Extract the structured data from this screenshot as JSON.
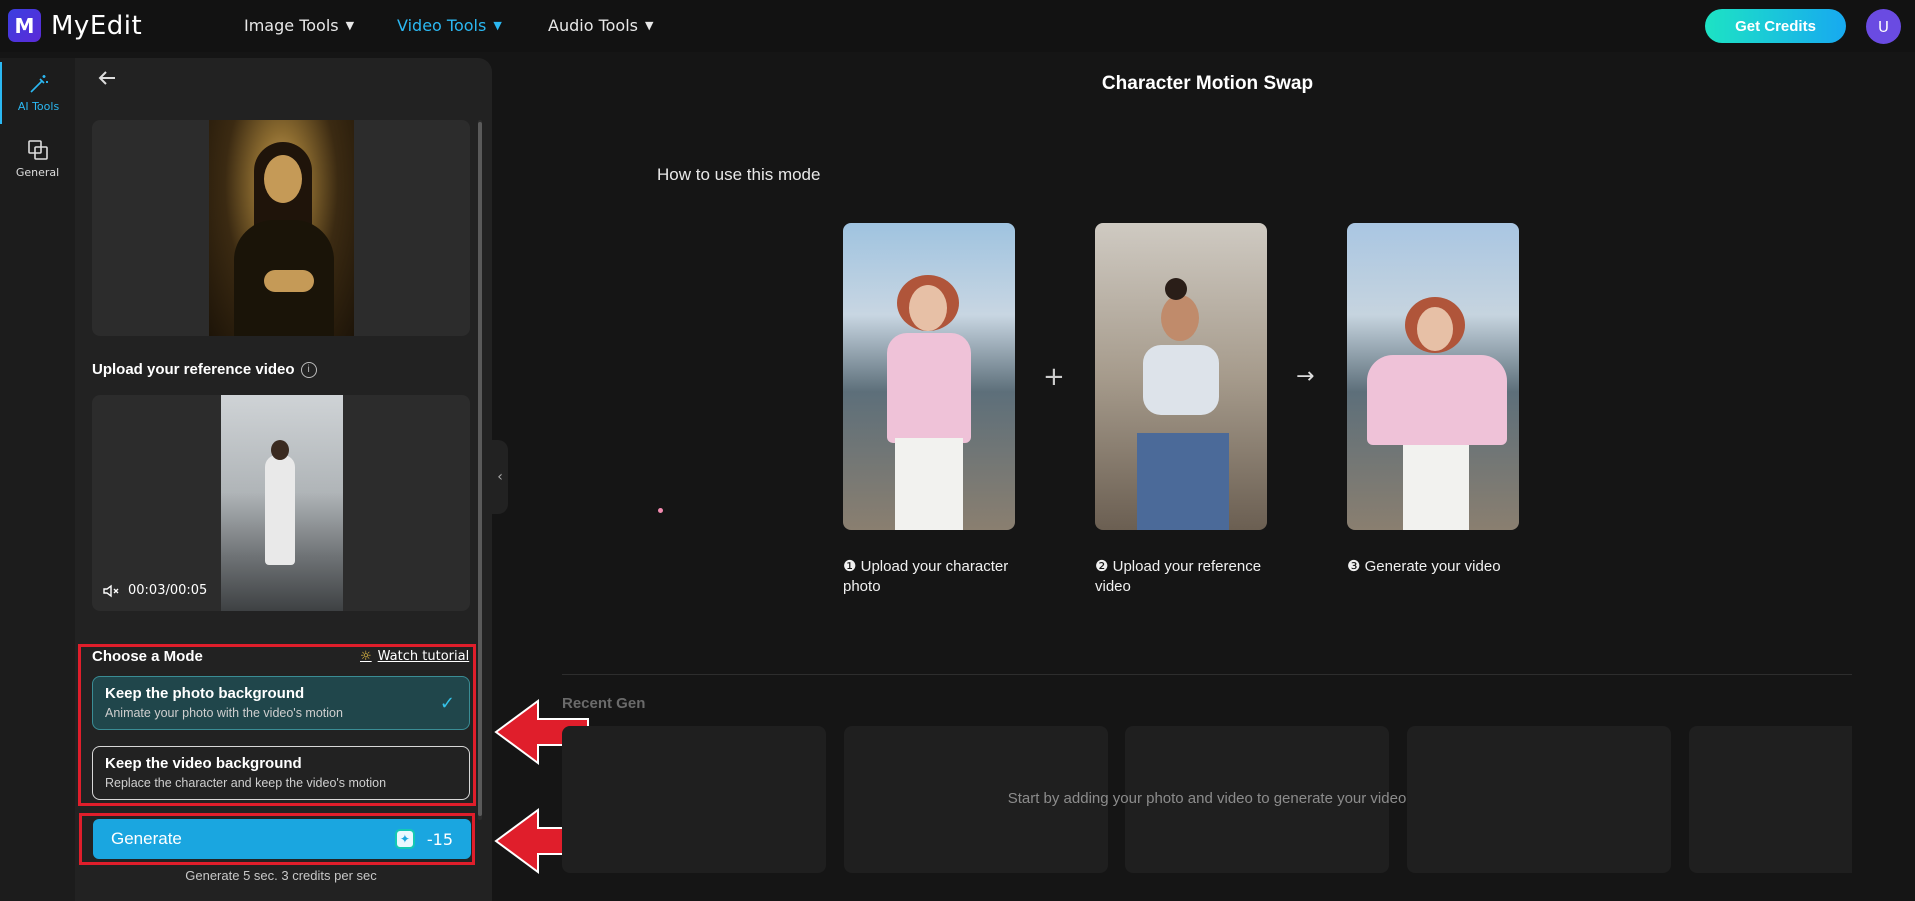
{
  "app": {
    "name": "MyEdit",
    "logo_letter": "M"
  },
  "nav": [
    {
      "label": "Image Tools",
      "active": false
    },
    {
      "label": "Video Tools",
      "active": true
    },
    {
      "label": "Audio Tools",
      "active": false
    }
  ],
  "header": {
    "credits_label": "Get Credits",
    "avatar_letter": "U"
  },
  "rail": [
    {
      "label": "AI Tools",
      "icon": "magic-wand-icon",
      "active": true
    },
    {
      "label": "General",
      "icon": "layers-icon",
      "active": false
    }
  ],
  "panel": {
    "reference_label": "Upload your reference video",
    "video_time": "00:03/00:05",
    "mode_title": "Choose a Mode",
    "watch_tutorial": "Watch tutorial",
    "modes": [
      {
        "title": "Keep the photo background",
        "desc": "Animate your photo with the video's motion",
        "selected": true
      },
      {
        "title": "Keep the video background",
        "desc": "Replace the character and keep the video's motion",
        "selected": false
      }
    ],
    "generate_label": "Generate",
    "generate_cost": "-15",
    "generate_note": "Generate 5 sec. 3 credits per sec"
  },
  "main": {
    "title": "Character Motion Swap",
    "howto": "How to use this mode",
    "steps": [
      {
        "num": "❶",
        "caption": "Upload your character photo"
      },
      {
        "num": "❷",
        "caption": "Upload your reference video"
      },
      {
        "num": "❸",
        "caption": "Generate your video"
      }
    ],
    "recent_label": "Recent Gen",
    "recent_message": "Start by adding your photo and video to generate your video"
  },
  "colors": {
    "accent": "#2bb8f2",
    "highlight_box": "#e01e2b",
    "generate_btn": "#1aa6e0"
  }
}
